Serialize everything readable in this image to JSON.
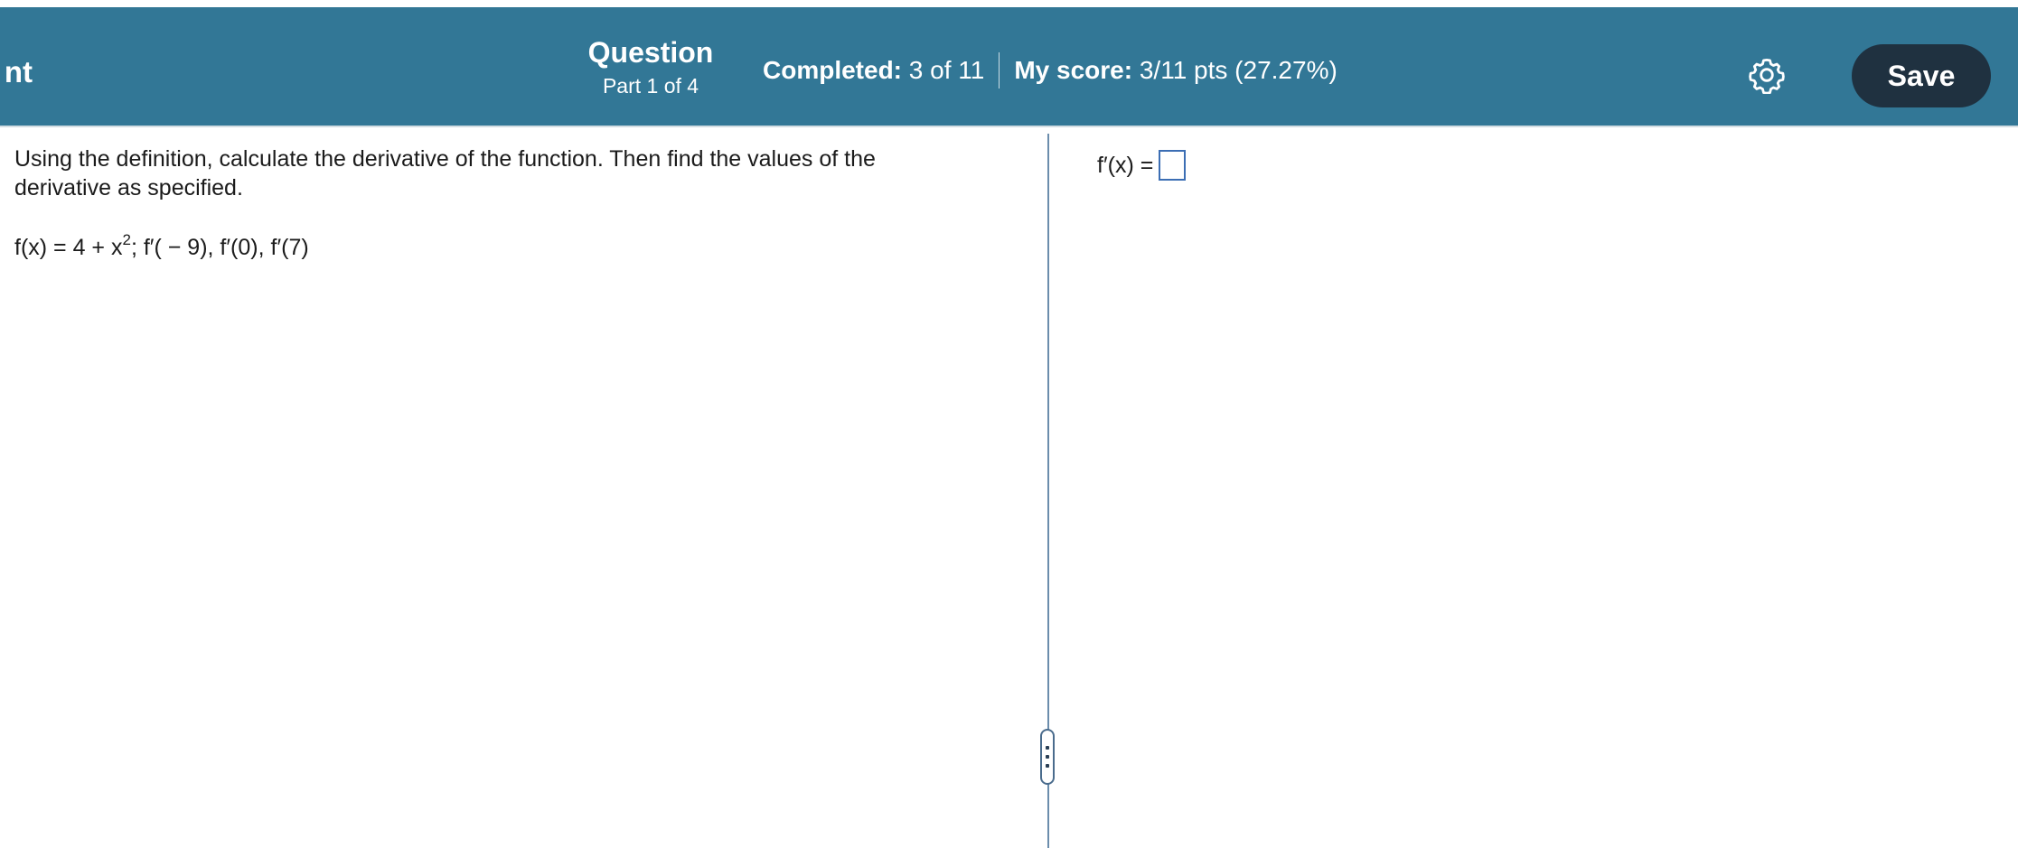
{
  "header": {
    "app_title": "Assignment",
    "app_title_visible": "nt",
    "question_label": "Question",
    "part_label": "Part 1 of 4",
    "completed_label": "Completed:",
    "completed_value": "3 of 11",
    "score_label": "My score:",
    "score_value": "3/11 pts (27.27%)",
    "settings_icon": "gear-icon",
    "save_label": "Save",
    "background_color": "#327796",
    "save_button_color": "#1f3140"
  },
  "problem": {
    "instructions": "Using the definition, calculate the derivative of the function. Then find the values of the derivative as specified.",
    "function_prefix": "f(x) = 4 + x",
    "function_exponent": "2",
    "function_suffix": "; f′( − 9), f′(0), f′(7)"
  },
  "answer": {
    "label": "f′(x) =",
    "value": ""
  },
  "splitter": {
    "handle_icon": "drag-handle-icon"
  }
}
